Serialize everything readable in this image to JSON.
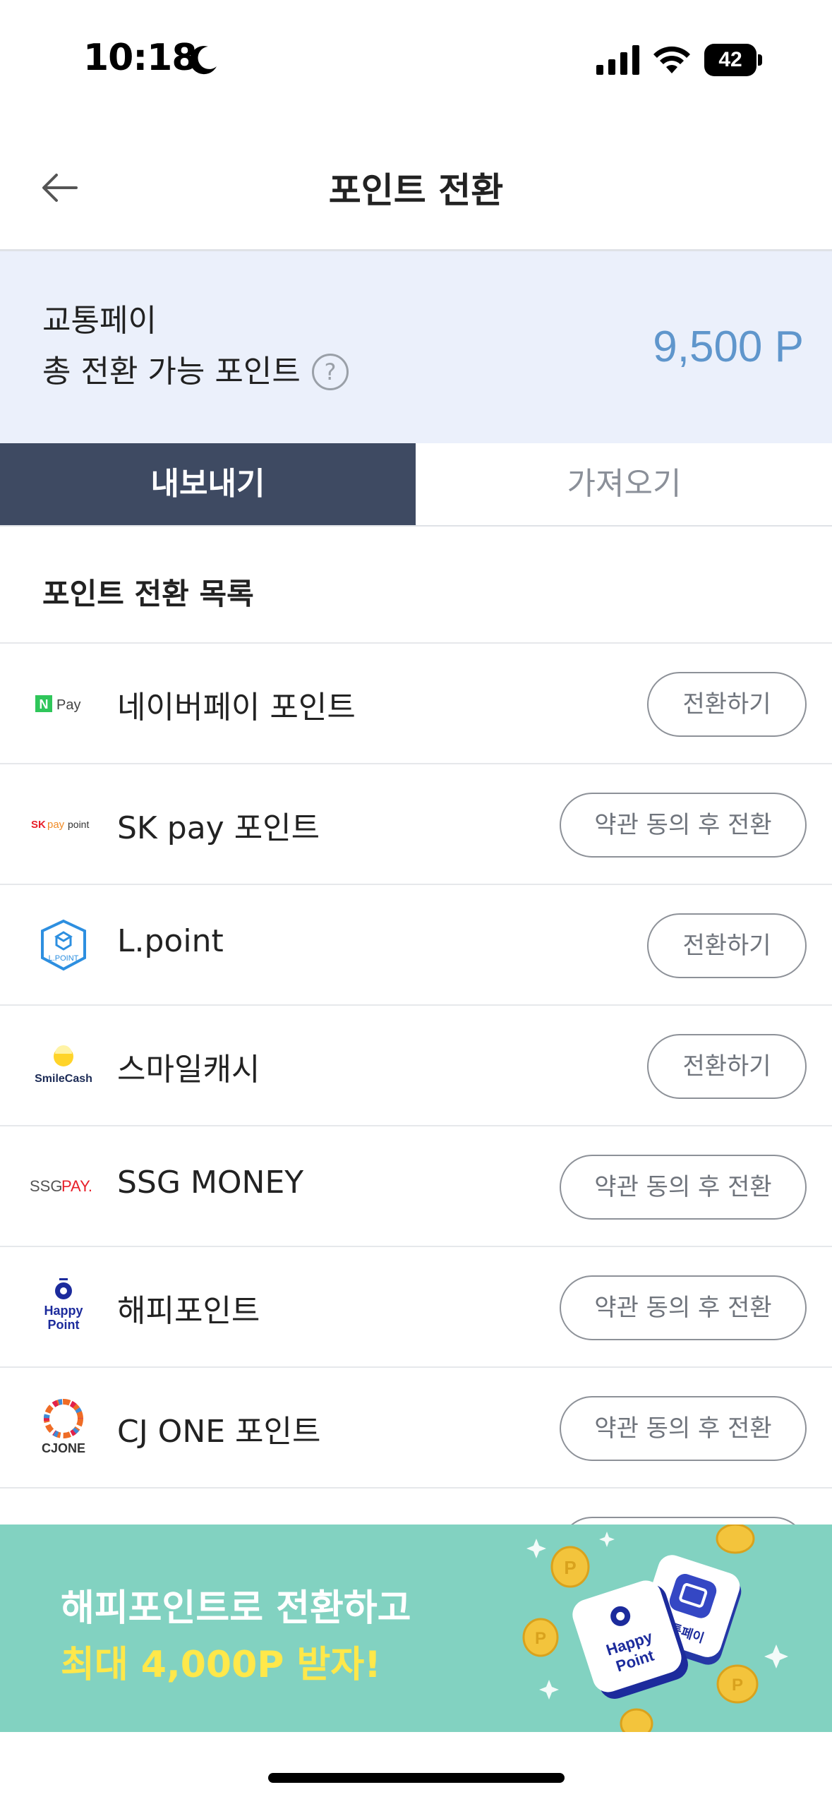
{
  "status_bar": {
    "time": "10:18",
    "battery": "42"
  },
  "header": {
    "title": "포인트 전환"
  },
  "summary": {
    "label_brand": "교통페이",
    "label_total": "총 전환 가능 포인트",
    "help": "?",
    "points": "9,500 P"
  },
  "tabs": [
    {
      "label": "내보내기",
      "active": true
    },
    {
      "label": "가져오기",
      "active": false
    }
  ],
  "list": {
    "title": "포인트 전환 목록",
    "items": [
      {
        "name": "네이버페이 포인트",
        "button": "전환하기",
        "logo_text": "Pay"
      },
      {
        "name": "SK pay 포인트",
        "button": "약관 동의 후 전환",
        "logo_text": "SKpay point"
      },
      {
        "name": "L.point",
        "button": "전환하기",
        "logo_text": "L.POINT"
      },
      {
        "name": "스마일캐시",
        "button": "전환하기",
        "logo_text": "SmileCash"
      },
      {
        "name": "SSG MONEY",
        "button": "약관 동의 후 전환",
        "logo_text": "SSGPAY."
      },
      {
        "name": "해피포인트",
        "button": "약관 동의 후 전환",
        "logo_text": "Happy Point"
      },
      {
        "name": "CJ ONE 포인트",
        "button": "약관 동의 후 전환",
        "logo_text": "CJONE"
      }
    ]
  },
  "banner": {
    "line1": "해피포인트로 전환하고",
    "line2": "최대 4,000P 받자!",
    "card_left": "Happy Point",
    "card_right": "교통페이"
  },
  "colors": {
    "tab_active_bg": "#3e4a62",
    "summary_bg": "#ebf0fb",
    "points": "#5f96cc",
    "banner_bg": "#82d2c1",
    "banner_highlight": "#ffe84a"
  }
}
